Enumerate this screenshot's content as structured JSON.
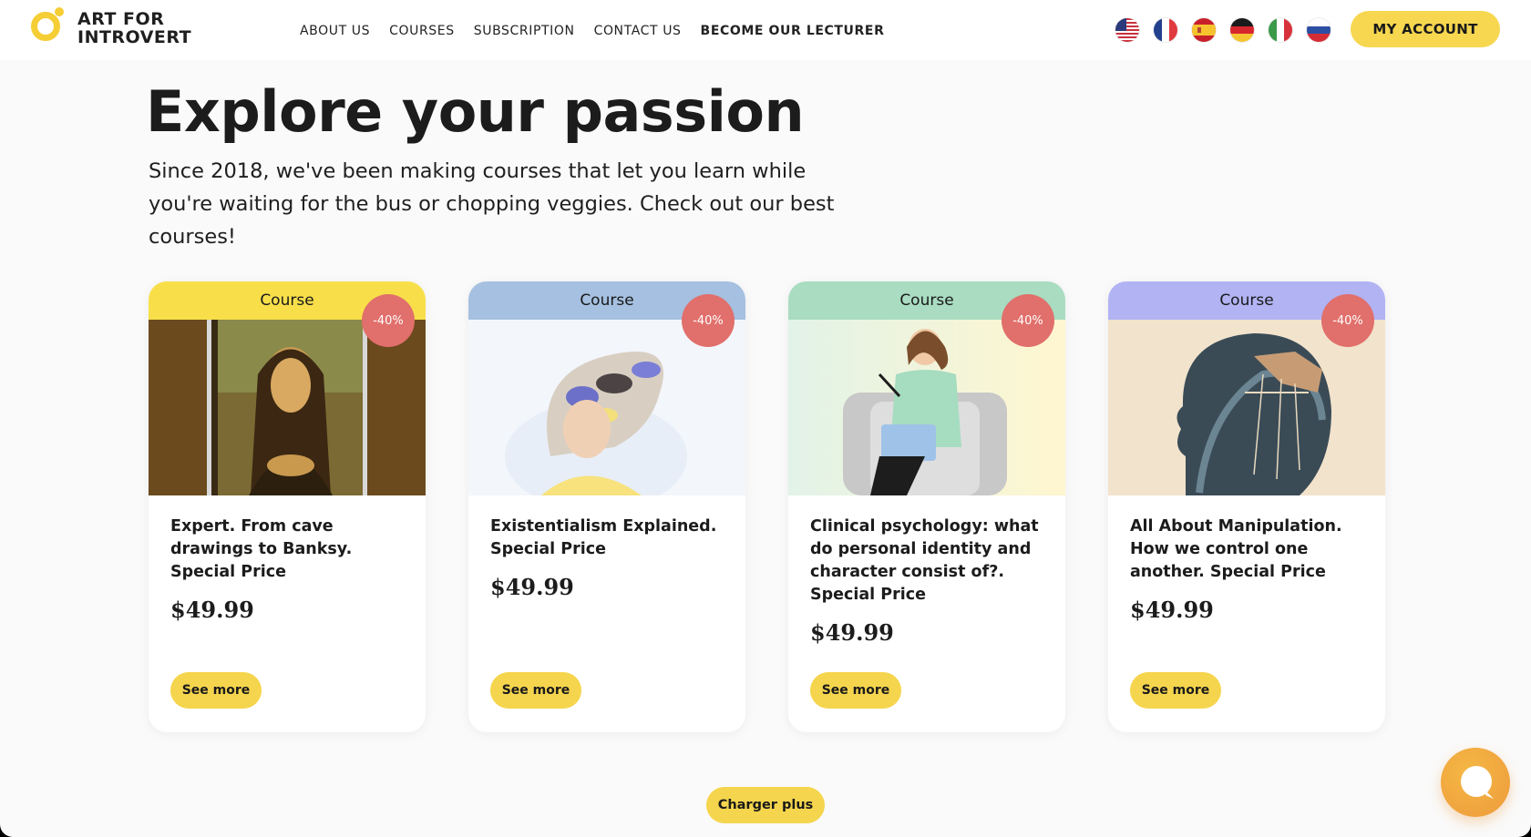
{
  "brand": {
    "line1": "ART FOR",
    "line2": "INTROVERT",
    "accent": "#f5cd35"
  },
  "nav": {
    "items": [
      "ABOUT US",
      "COURSES",
      "SUBSCRIPTION",
      "CONTACT US",
      "BECOME OUR LECTURER"
    ]
  },
  "languages": [
    {
      "icon": "us-flag-icon"
    },
    {
      "icon": "france-flag-icon"
    },
    {
      "icon": "spain-flag-icon"
    },
    {
      "icon": "germany-flag-icon"
    },
    {
      "icon": "italy-flag-icon"
    },
    {
      "icon": "russia-flag-icon"
    }
  ],
  "account_button": "MY ACCOUNT",
  "hero": {
    "title": "Explore your passion",
    "subtitle": "Since 2018, we've been making courses that let you learn while you're waiting for the bus or chopping veggies. Check out our best courses!"
  },
  "cards": [
    {
      "tag": "Course",
      "badge": "-40%",
      "title": "Expert. From cave drawings to Banksy. Special Price",
      "price": "$49.99",
      "button": "See more",
      "color": "#f8df4a"
    },
    {
      "tag": "Course",
      "badge": "-40%",
      "title": "Existentialism Explained. Special Price",
      "price": "$49.99",
      "button": "See more",
      "color": "#a5c0e0"
    },
    {
      "tag": "Course",
      "badge": "-40%",
      "title": "Clinical psychology: what do personal identity and character consist of?. Special Price",
      "price": "$49.99",
      "button": "See more",
      "color": "#a9dcc0"
    },
    {
      "tag": "Course",
      "badge": "-40%",
      "title": "All About Manipulation. How we control one another. Special Price",
      "price": "$49.99",
      "button": "See more",
      "color": "#b1b3f3"
    }
  ],
  "load_more": "Charger plus",
  "chat_icon": "chat-bubble-icon"
}
